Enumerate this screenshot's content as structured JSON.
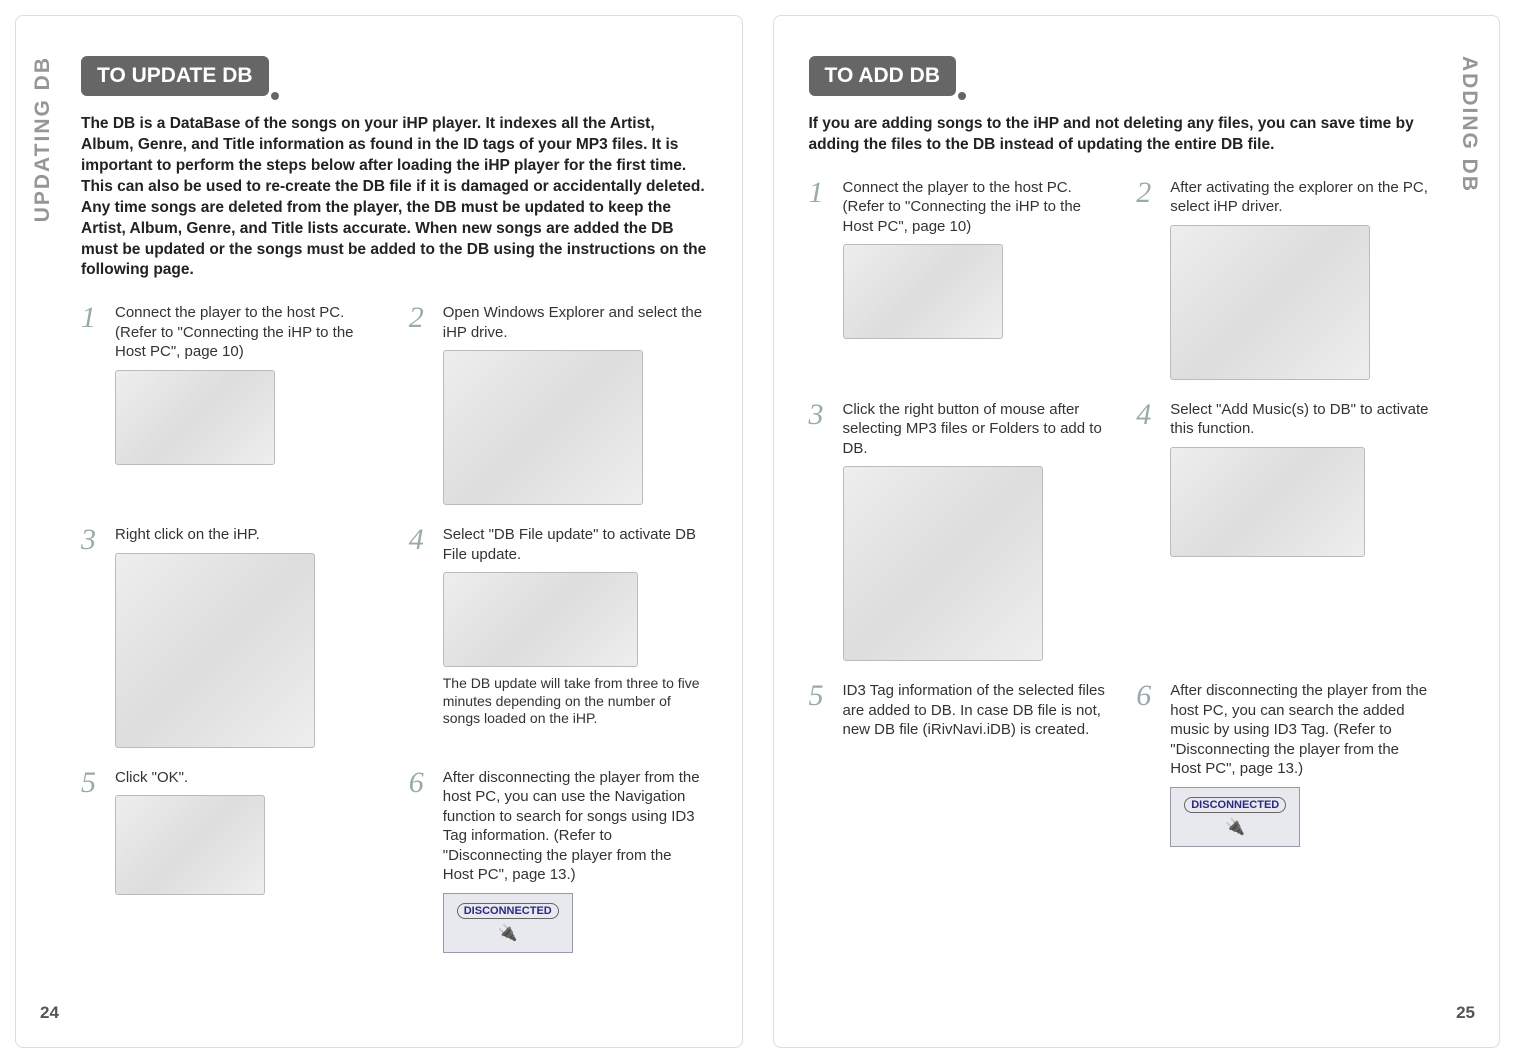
{
  "left": {
    "side_label": "UPDATING DB",
    "heading": "TO UPDATE DB",
    "intro": "The DB is a DataBase of the songs on your iHP player. It indexes all the Artist, Album, Genre, and Title information as found in the ID tags of your MP3 files. It is important to perform the steps below after loading the iHP player for the first time. This can also be used to re-create the DB file if it is damaged or accidentally deleted. Any time songs are deleted from the player, the DB must be updated to keep the Artist, Album, Genre, and Title lists accurate. When new songs are added the DB must be updated or the songs must be added to the DB using the instructions on the following page.",
    "steps": {
      "s1": {
        "num": "1",
        "text": "Connect the player to the host PC. (Refer to \"Connecting the iHP to the Host PC\", page 10)"
      },
      "s2": {
        "num": "2",
        "text": "Open Windows Explorer and select the iHP drive."
      },
      "s3": {
        "num": "3",
        "text": "Right click on the iHP."
      },
      "s4": {
        "num": "4",
        "text": "Select \"DB File update\" to activate DB File update.",
        "note": "The DB update will take from three to five minutes depending on the number of songs loaded on the iHP."
      },
      "s5": {
        "num": "5",
        "text": "Click \"OK\"."
      },
      "s6": {
        "num": "6",
        "text": "After disconnecting the player from the host PC, you can use the Navigation function to search for songs using ID3 Tag information. (Refer to \"Disconnecting the player from the Host PC\", page 13.)"
      }
    },
    "disconnect_label": "DISCONNECTED",
    "page_num": "24"
  },
  "right": {
    "side_label": "ADDING DB",
    "heading": "TO ADD DB",
    "intro": "If you are adding songs to the iHP and not deleting any files, you can save time by adding the files to the DB instead of updating the entire DB file.",
    "steps": {
      "s1": {
        "num": "1",
        "text": "Connect the player to the host PC. (Refer to \"Connecting the iHP to the Host PC\", page 10)"
      },
      "s2": {
        "num": "2",
        "text": "After activating the explorer on the PC, select iHP driver."
      },
      "s3": {
        "num": "3",
        "text": "Click the right button of mouse after selecting MP3 files or Folders to add to DB."
      },
      "s4": {
        "num": "4",
        "text": "Select \"Add Music(s) to DB\" to activate this function."
      },
      "s5": {
        "num": "5",
        "text": "ID3 Tag information of the selected files are added to DB. In case DB file is not, new DB file (iRivNavi.iDB) is created."
      },
      "s6": {
        "num": "6",
        "text": "After disconnecting the player from the host PC, you can search the added music by using ID3 Tag. (Refer to \"Disconnecting the player from the Host PC\", page 13.)"
      }
    },
    "disconnect_label": "DISCONNECTED",
    "page_num": "25"
  }
}
